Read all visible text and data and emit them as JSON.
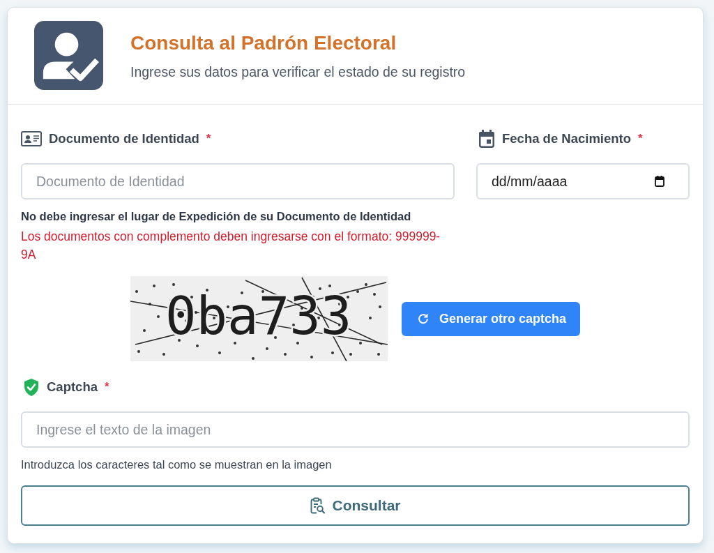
{
  "header": {
    "title": "Consulta al Padrón Electoral",
    "subtitle": "Ingrese sus datos para verificar el estado de su registro"
  },
  "fields": [
    {
      "kind": "document",
      "label": "Documento de Identidad",
      "required_mark": "*",
      "placeholder": "Documento de Identidad",
      "notes": [
        {
          "kind": "instruction",
          "text": "No debe ingresar el lugar de Expedición de su Documento de Identidad"
        },
        {
          "kind": "warning",
          "text": "Los documentos con complemento deben ingresarse con el formato: 999999-9A"
        }
      ]
    },
    {
      "kind": "date",
      "label": "Fecha de Nacimiento",
      "required_mark": "*",
      "value": "dd/mm/aaaa"
    }
  ],
  "captcha": {
    "text": "0ba733",
    "refresh_button": "Generar otro captcha"
  },
  "captcha_field": {
    "kind": "captcha",
    "label": "Captcha",
    "required_mark": "*",
    "placeholder": "Ingrese el texto de la imagen",
    "hint": "Introduzca los caracteres tal como se muestran en la imagen"
  },
  "submit_button": "Consultar"
}
